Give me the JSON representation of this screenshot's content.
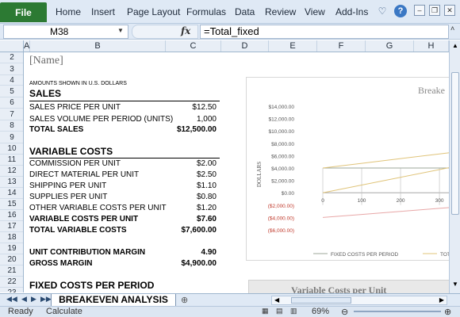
{
  "ribbon": {
    "file_label": "File",
    "tabs": [
      "Home",
      "Insert",
      "Page Layout",
      "Formulas",
      "Data",
      "Review",
      "View",
      "Add-Ins"
    ]
  },
  "formula_bar": {
    "name_box": "M38",
    "fx_label": "fx",
    "formula": "=Total_fixed"
  },
  "columns": [
    "A",
    "B",
    "C",
    "D",
    "E",
    "F",
    "G",
    "H"
  ],
  "rows": [
    "2",
    "3",
    "4",
    "5",
    "6",
    "7",
    "8",
    "9",
    "10",
    "11",
    "12",
    "13",
    "14",
    "15",
    "16",
    "17",
    "18",
    "19",
    "20",
    "21",
    "22",
    "23"
  ],
  "sheet": {
    "name_placeholder": "[Name]",
    "amounts_note": "AMOUNTS SHOWN IN U.S. DOLLARS",
    "sales_header": "SALES",
    "sales_price_label": "SALES PRICE PER UNIT",
    "sales_price_value": "$12.50",
    "sales_volume_label": "SALES VOLUME PER PERIOD (UNITS)",
    "sales_volume_value": "1,000",
    "total_sales_label": "TOTAL SALES",
    "total_sales_value": "$12,500.00",
    "variable_costs_header": "VARIABLE COSTS",
    "commission_label": "COMMISSION PER UNIT",
    "commission_value": "$2.00",
    "direct_material_label": "DIRECT MATERIAL PER UNIT",
    "direct_material_value": "$2.50",
    "shipping_label": "SHIPPING PER UNIT",
    "shipping_value": "$1.10",
    "supplies_label": "SUPPLIES PER UNIT",
    "supplies_value": "$0.80",
    "other_label": "OTHER VARIABLE COSTS PER UNIT",
    "other_value": "$1.20",
    "var_per_unit_label": "VARIABLE COSTS PER UNIT",
    "var_per_unit_value": "$7.60",
    "total_var_label": "TOTAL VARIABLE COSTS",
    "total_var_value": "$7,600.00",
    "ucm_label": "UNIT CONTRIBUTION MARGIN",
    "ucm_value": "4.90",
    "gross_margin_label": "GROSS MARGIN",
    "gross_margin_value": "$4,900.00",
    "fixed_costs_header": "FIXED COSTS PER PERIOD"
  },
  "chart_data": {
    "type": "line",
    "title": "Breake",
    "ylabel": "DOLLARS",
    "y_ticks": [
      "$14,000.00",
      "$12,000.00",
      "$10,000.00",
      "$8,000.00",
      "$6,000.00",
      "$4,000.00",
      "$2,000.00",
      "$0.00",
      "($2,000.00)",
      "($4,000.00)",
      "($6,000.00)"
    ],
    "x_ticks": [
      "0",
      "100",
      "200",
      "300"
    ],
    "ylim": [
      -6000,
      14000
    ],
    "series": [
      {
        "name": "FIXED COSTS PER PERIOD",
        "color": "#9ca79a",
        "x": [
          0,
          100,
          200,
          300,
          400
        ],
        "y": [
          4000,
          4000,
          4000,
          4000,
          4000
        ]
      },
      {
        "name": "TOTAL COSTS",
        "color": "#e0c47a",
        "x": [
          0,
          100,
          200,
          300,
          400
        ],
        "y": [
          4000,
          4760,
          5520,
          6280,
          7040
        ]
      },
      {
        "name": "",
        "color": "#e0c47a",
        "x": [
          0,
          100,
          200,
          300,
          400
        ],
        "y": [
          0,
          1250,
          2500,
          3750,
          5000
        ]
      },
      {
        "name": "",
        "color": "#e8a7a7",
        "x": [
          0,
          100,
          200,
          300,
          400
        ],
        "y": [
          -4000,
          -3510,
          -3020,
          -2530,
          -2040
        ]
      }
    ],
    "legend": [
      "FIXED COSTS PER PERIOD",
      "TOT"
    ],
    "grid": true
  },
  "chart2": {
    "title": "Variable Costs per Unit"
  },
  "tabs_bar": {
    "sheet_name": "BREAKEVEN ANALYSIS"
  },
  "status": {
    "ready": "Ready",
    "calculate": "Calculate",
    "zoom": "69%"
  }
}
